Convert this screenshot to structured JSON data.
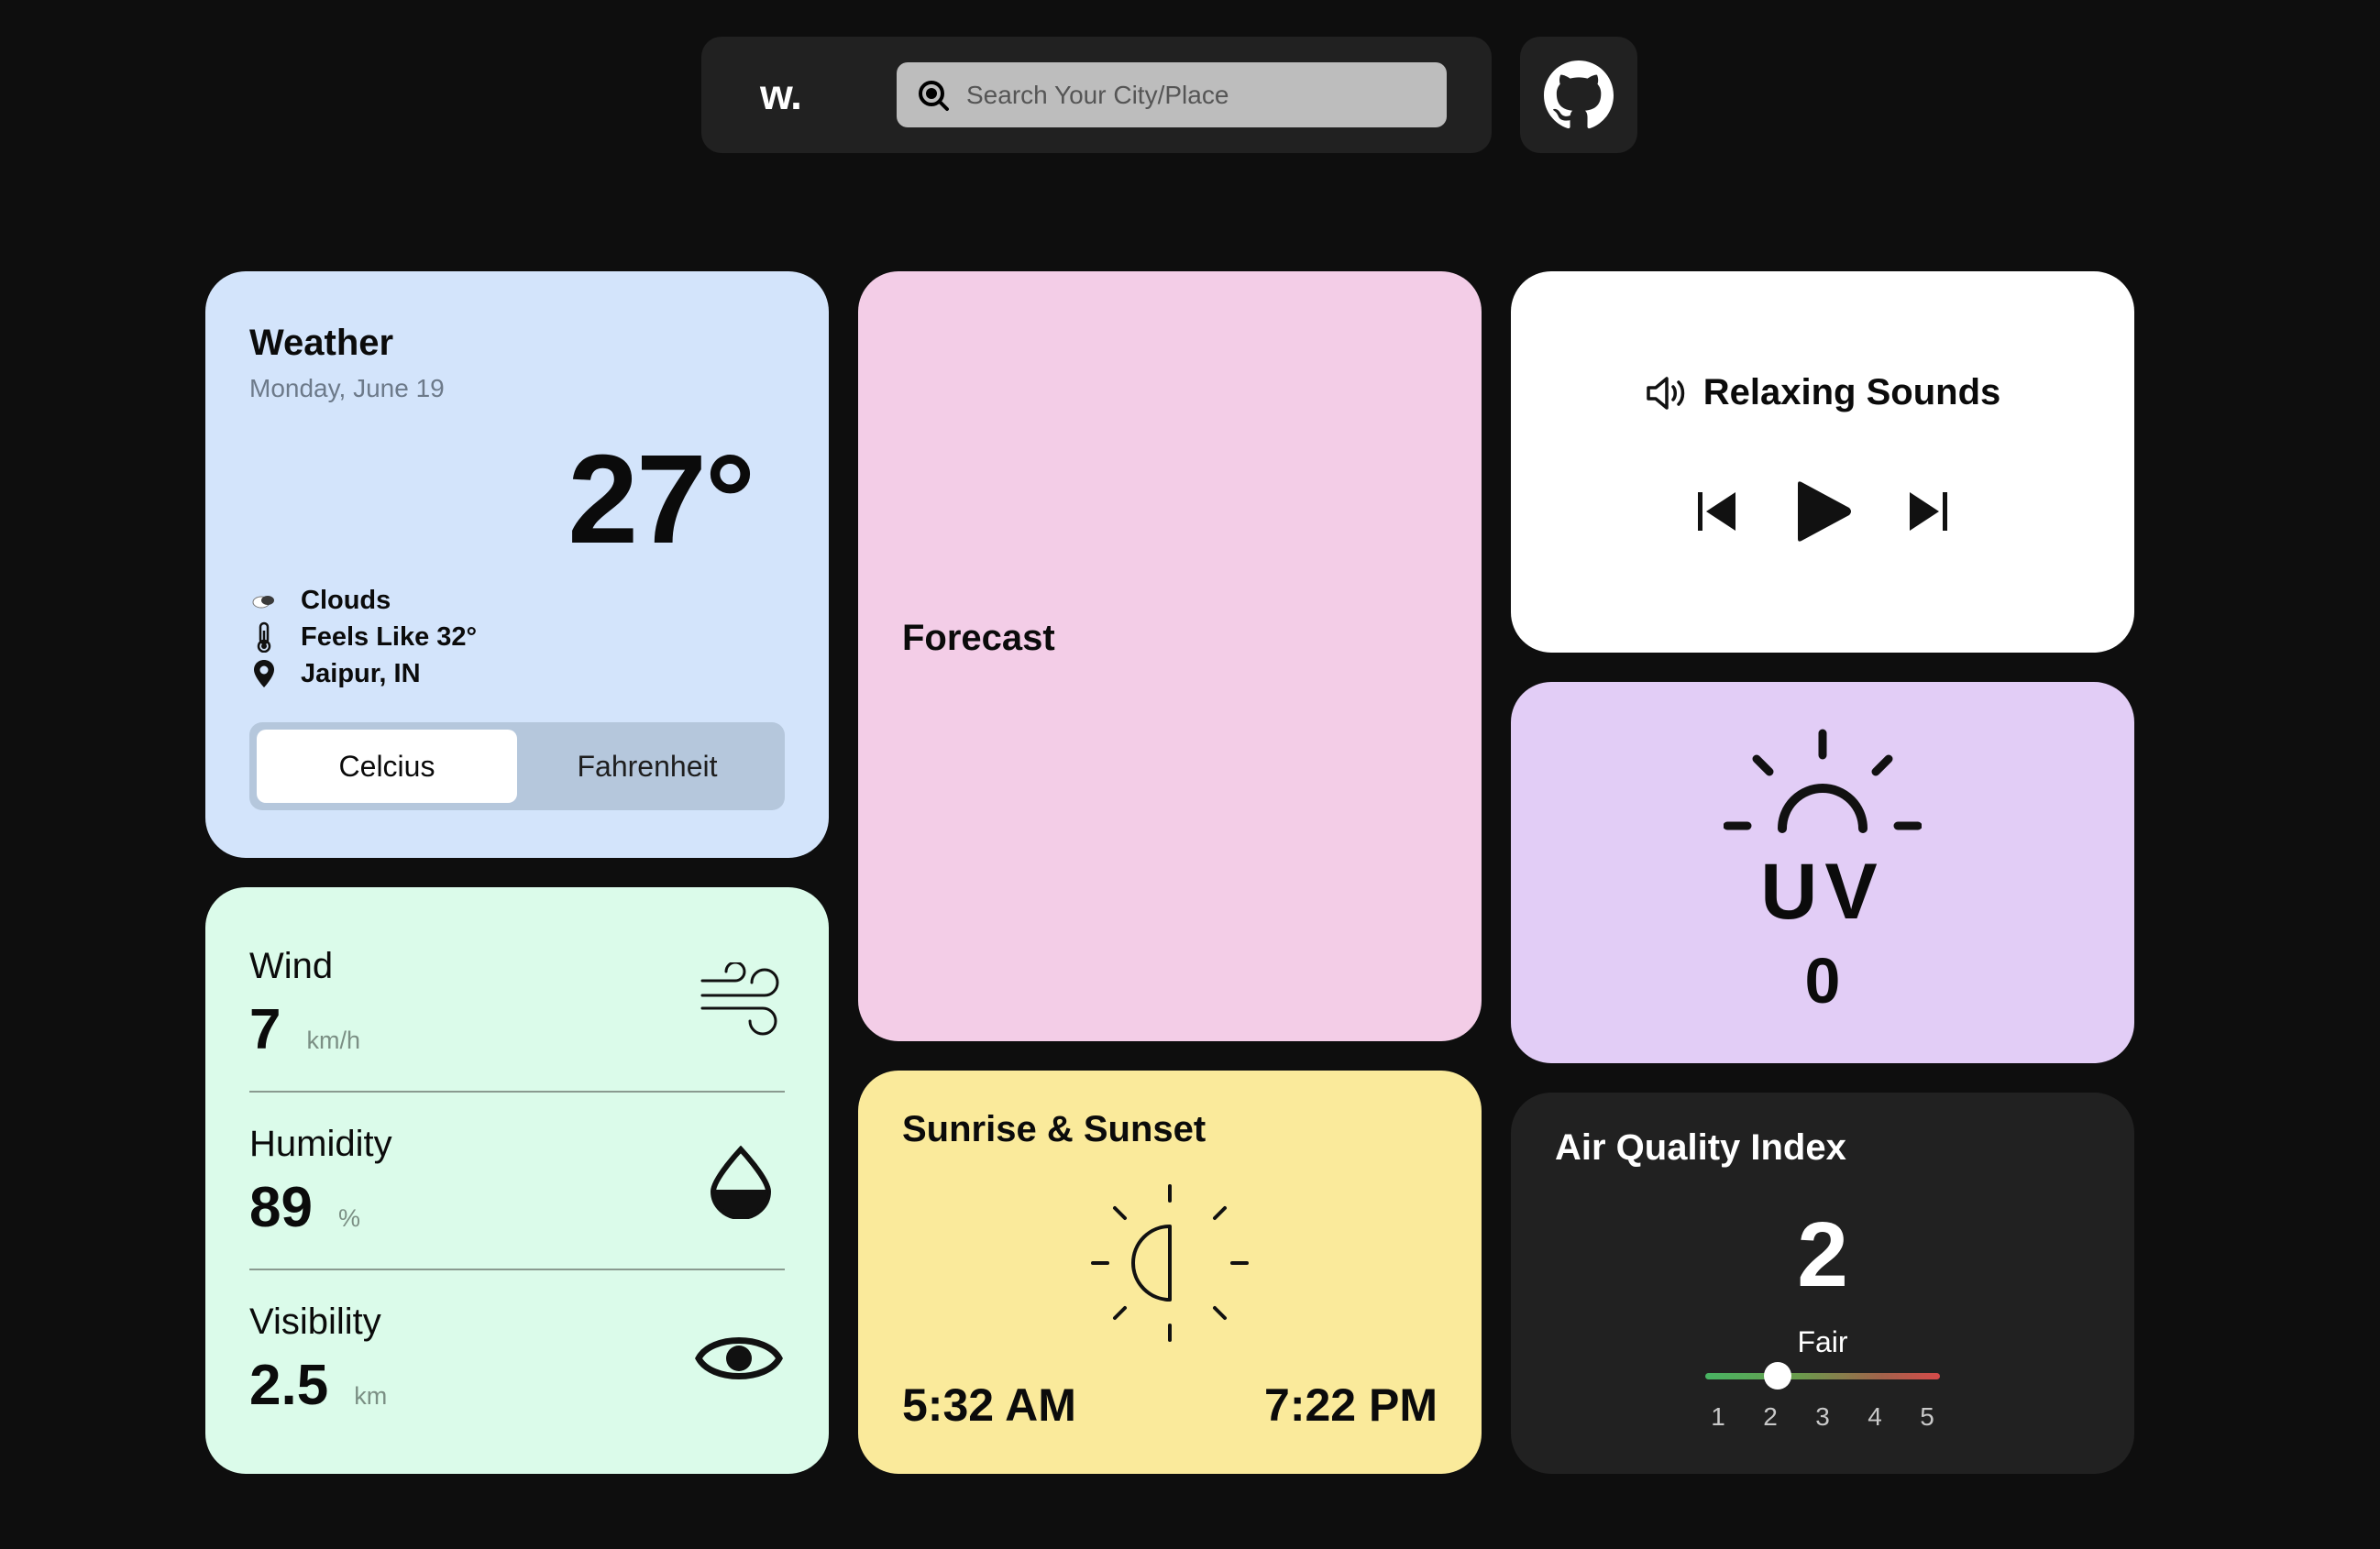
{
  "header": {
    "logo": "w.",
    "search_placeholder": "Search Your City/Place"
  },
  "weather": {
    "title": "Weather",
    "date": "Monday, June 19",
    "temperature": "27°",
    "condition": "Clouds",
    "feels_like": "Feels Like 32°",
    "location": "Jaipur, IN",
    "units": {
      "celsius": "Celcius",
      "fahrenheit": "Fahrenheit",
      "selected": "Celcius"
    }
  },
  "forecast": {
    "title": "Forecast"
  },
  "sounds": {
    "title": "Relaxing Sounds"
  },
  "uv": {
    "label": "UV",
    "value": "0"
  },
  "stats": {
    "wind": {
      "label": "Wind",
      "value": "7",
      "unit": "km/h"
    },
    "humidity": {
      "label": "Humidity",
      "value": "89",
      "unit": "%"
    },
    "visibility": {
      "label": "Visibility",
      "value": "2.5",
      "unit": "km"
    }
  },
  "sun": {
    "title": "Sunrise & Sunset",
    "sunrise": "5:32 AM",
    "sunset": "7:22 PM"
  },
  "aqi": {
    "title": "Air Quality Index",
    "value": "2",
    "category": "Fair",
    "scale": [
      "1",
      "2",
      "3",
      "4",
      "5"
    ],
    "level": 2
  },
  "colors": {
    "background": "#0e0e0e",
    "weather_card": "#d3e4fb",
    "forecast_card": "#f3cde7",
    "sounds_card": "#ffffff",
    "uv_card": "#e2cdf6",
    "stats_card": "#dbfbea",
    "sun_card": "#faea9b",
    "aqi_card": "#212121"
  },
  "icons": {
    "search": "search-icon",
    "github": "github-icon",
    "clouds": "cloud-icon",
    "thermometer": "thermometer-icon",
    "location": "location-pin-icon",
    "speaker": "speaker-icon",
    "previous": "skip-previous-icon",
    "play": "play-icon",
    "next": "skip-next-icon",
    "uv": "sunrise-uv-icon",
    "wind": "wind-icon",
    "humidity": "water-drop-icon",
    "visibility": "eye-icon",
    "sun": "half-sun-icon"
  }
}
